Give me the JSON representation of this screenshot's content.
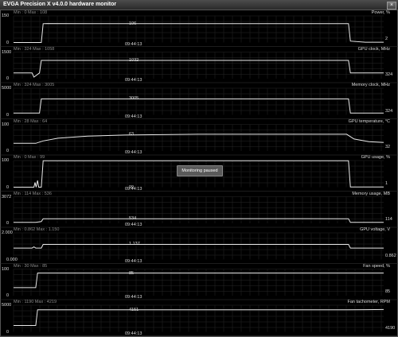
{
  "window": {
    "title": "EVGA Precision X v4.0.0 hardware monitor",
    "close_glyph": "×"
  },
  "overlay": {
    "paused_label": "Monitoring paused"
  },
  "colors": {
    "background": "#000000",
    "grid": "#262626",
    "line": "#e8e8e8",
    "text": "#dddddd"
  },
  "graphs": [
    {
      "name": "Power, %",
      "minmax": "Min : 0   Max : 108",
      "y_top": "150",
      "y_bottom": "0",
      "current": "106",
      "time": "09:44:13",
      "right_value": "2",
      "y_range": [
        0,
        150
      ],
      "series": [
        [
          0,
          0
        ],
        [
          0.02,
          0
        ],
        [
          0.075,
          0
        ],
        [
          0.08,
          106
        ],
        [
          0.09,
          107
        ],
        [
          0.2,
          106
        ],
        [
          0.5,
          106
        ],
        [
          0.7,
          106
        ],
        [
          0.905,
          106
        ],
        [
          0.91,
          8
        ],
        [
          0.95,
          2
        ],
        [
          1,
          2
        ]
      ]
    },
    {
      "name": "GPU clock, MHz",
      "minmax": "Min : 324   Max : 1058",
      "y_top": "1500",
      "y_bottom": "0",
      "current": "1032",
      "time": "09:44:13",
      "right_value": "324",
      "y_range": [
        0,
        1500
      ],
      "series": [
        [
          0,
          324
        ],
        [
          0.02,
          324
        ],
        [
          0.05,
          324
        ],
        [
          0.055,
          90
        ],
        [
          0.07,
          324
        ],
        [
          0.075,
          1032
        ],
        [
          0.5,
          1032
        ],
        [
          0.905,
          1032
        ],
        [
          0.91,
          324
        ],
        [
          1,
          324
        ]
      ]
    },
    {
      "name": "Memory clock, MHz",
      "minmax": "Min : 324   Max : 3005",
      "y_top": "5000",
      "y_bottom": "0",
      "current": "3005",
      "time": "09:44:13",
      "right_value": "324",
      "y_range": [
        0,
        5000
      ],
      "series": [
        [
          0,
          324
        ],
        [
          0.07,
          324
        ],
        [
          0.075,
          3005
        ],
        [
          0.5,
          3005
        ],
        [
          0.905,
          3005
        ],
        [
          0.91,
          324
        ],
        [
          1,
          324
        ]
      ]
    },
    {
      "name": "GPU temperature, °C",
      "minmax": "Min : 28   Max : 64",
      "y_top": "100",
      "y_bottom": "0",
      "current": "63",
      "time": "09:44:13",
      "right_value": "32",
      "y_range": [
        0,
        100
      ],
      "series": [
        [
          0,
          29
        ],
        [
          0.06,
          29
        ],
        [
          0.08,
          38
        ],
        [
          0.12,
          48
        ],
        [
          0.2,
          56
        ],
        [
          0.3,
          60
        ],
        [
          0.5,
          63
        ],
        [
          0.7,
          63
        ],
        [
          0.9,
          63
        ],
        [
          0.92,
          45
        ],
        [
          0.96,
          35
        ],
        [
          1,
          32
        ]
      ]
    },
    {
      "name": "GPU usage, %",
      "minmax": "Min : 0   Max : 99",
      "y_top": "100",
      "y_bottom": "0",
      "current": "99",
      "time": "09:44:13",
      "right_value": "1",
      "y_range": [
        0,
        100
      ],
      "series": [
        [
          0,
          0
        ],
        [
          0.055,
          0
        ],
        [
          0.058,
          18
        ],
        [
          0.061,
          0
        ],
        [
          0.065,
          25
        ],
        [
          0.068,
          0
        ],
        [
          0.075,
          0
        ],
        [
          0.08,
          99
        ],
        [
          0.5,
          99
        ],
        [
          0.905,
          99
        ],
        [
          0.91,
          1
        ],
        [
          1,
          1
        ]
      ]
    },
    {
      "name": "Memory usage, MB",
      "minmax": "Min : 114   Max : 536",
      "y_top": "3072",
      "y_bottom": "0",
      "current": "534",
      "time": "09:44:13",
      "right_value": "114",
      "y_range": [
        0,
        3072
      ],
      "series": [
        [
          0,
          114
        ],
        [
          0.06,
          114
        ],
        [
          0.075,
          200
        ],
        [
          0.08,
          534
        ],
        [
          0.5,
          534
        ],
        [
          0.62,
          540
        ],
        [
          0.905,
          534
        ],
        [
          0.91,
          114
        ],
        [
          1,
          114
        ]
      ]
    },
    {
      "name": "GPU voltage, V",
      "minmax": "Min : 0.862   Max : 1.150",
      "y_top": "2.000",
      "y_bottom": "0.000",
      "current": "1.137",
      "time": "09:44:13",
      "right_value": "0.862",
      "y_range": [
        0,
        2
      ],
      "series": [
        [
          0,
          0.862
        ],
        [
          0.05,
          0.862
        ],
        [
          0.055,
          0.95
        ],
        [
          0.06,
          0.862
        ],
        [
          0.075,
          0.862
        ],
        [
          0.08,
          1.137
        ],
        [
          0.5,
          1.137
        ],
        [
          0.905,
          1.137
        ],
        [
          0.91,
          0.862
        ],
        [
          1,
          0.862
        ]
      ]
    },
    {
      "name": "Fan speed, %",
      "minmax": "Min : 30   Max : 85",
      "y_top": "100",
      "y_bottom": "0",
      "current": "85",
      "time": "09:44:13",
      "right_value": "85",
      "y_range": [
        0,
        100
      ],
      "series": [
        [
          0,
          30
        ],
        [
          0.06,
          30
        ],
        [
          0.065,
          85
        ],
        [
          0.5,
          85
        ],
        [
          1,
          85
        ]
      ]
    },
    {
      "name": "Fan tachometer, RPM",
      "minmax": "Min : 1190   Max : 4219",
      "y_top": "5000",
      "y_bottom": "0",
      "current": "4151",
      "time": "09:44:13",
      "right_value": "4190",
      "y_range": [
        0,
        5000
      ],
      "series": [
        [
          0,
          1190
        ],
        [
          0.06,
          1190
        ],
        [
          0.065,
          4151
        ],
        [
          0.5,
          4151
        ],
        [
          0.9,
          4151
        ],
        [
          0.95,
          4170
        ],
        [
          1,
          4190
        ]
      ]
    }
  ]
}
